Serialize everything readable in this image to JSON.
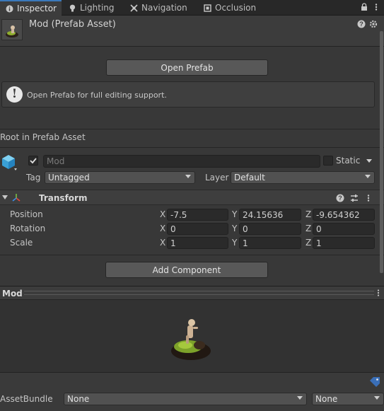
{
  "tabs": [
    {
      "label": "Inspector",
      "icon": "info-icon"
    },
    {
      "label": "Lighting",
      "icon": "lightbulb-icon"
    },
    {
      "label": "Navigation",
      "icon": "navigation-icon"
    },
    {
      "label": "Occlusion",
      "icon": "occlusion-icon"
    }
  ],
  "header": {
    "title": "Mod (Prefab Asset)"
  },
  "open_prefab_label": "Open Prefab",
  "help_text": "Open Prefab for full editing support.",
  "root_label": "Root in Prefab Asset",
  "object": {
    "active": true,
    "name_placeholder": "Mod",
    "static_label": "Static",
    "tag_label": "Tag",
    "tag_value": "Untagged",
    "layer_label": "Layer",
    "layer_value": "Default"
  },
  "transform": {
    "title": "Transform",
    "rows": [
      {
        "label": "Position",
        "x": "-7.5",
        "y": "24.15636",
        "z": "-9.654362"
      },
      {
        "label": "Rotation",
        "x": "0",
        "y": "0",
        "z": "0"
      },
      {
        "label": "Scale",
        "x": "1",
        "y": "1",
        "z": "1"
      }
    ],
    "axis_labels": {
      "x": "X",
      "y": "Y",
      "z": "Z"
    }
  },
  "add_component_label": "Add Component",
  "preview": {
    "title": "Mod"
  },
  "asset_bundle": {
    "label": "AssetBundle",
    "bundle_value": "None",
    "variant_value": "None"
  },
  "colors": {
    "accent": "#3a79bb",
    "background": "#383838"
  }
}
